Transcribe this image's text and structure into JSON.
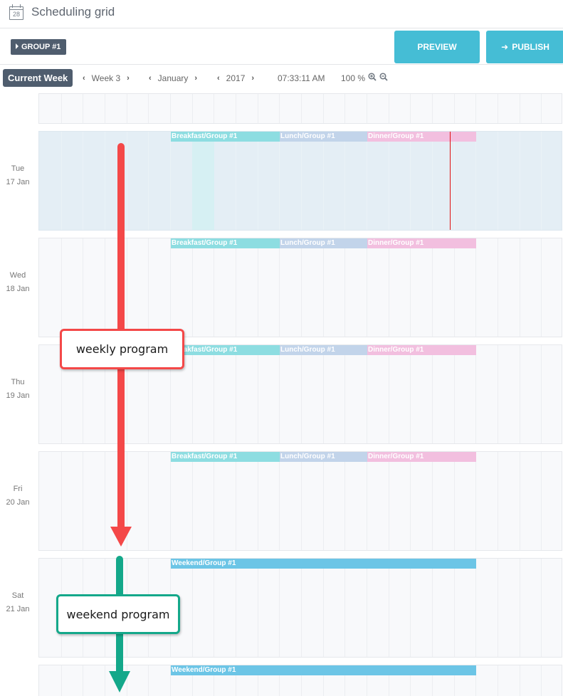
{
  "header": {
    "icon": "calendar-icon",
    "calendar_icon_number": "28",
    "title": "Scheduling grid"
  },
  "toolbar": {
    "group_label": "GROUP #1",
    "preview_label": "PREVIEW",
    "publish_label": "PUBLISH",
    "publish_icon": "arrow-right-icon"
  },
  "navbar": {
    "current_week_label": "Current Week",
    "week": "Week 3",
    "month": "January",
    "year": "2017",
    "clock": "07:33:11 AM",
    "zoom_level": "100 %",
    "zoom_in_icon": "zoom-in-icon",
    "zoom_out_icon": "zoom-out-icon"
  },
  "grid": {
    "hours_per_day": 24,
    "current_time_hour": 18.8,
    "highlight_hour": 7,
    "days": [
      {
        "weekday": "",
        "date": "",
        "partial": true,
        "events": []
      },
      {
        "weekday": "Tue",
        "date": "17 Jan",
        "today": true,
        "events": [
          {
            "label": "Breakfast/Group #1",
            "start": 6,
            "end": 11,
            "color": "#8ddde1"
          },
          {
            "label": "Lunch/Group #1",
            "start": 11,
            "end": 15,
            "color": "#c2d4ea"
          },
          {
            "label": "Dinner/Group #1",
            "start": 15,
            "end": 20,
            "color": "#f2bfdf"
          }
        ]
      },
      {
        "weekday": "Wed",
        "date": "18 Jan",
        "events": [
          {
            "label": "Breakfast/Group #1",
            "start": 6,
            "end": 11,
            "color": "#8ddde1"
          },
          {
            "label": "Lunch/Group #1",
            "start": 11,
            "end": 15,
            "color": "#c2d4ea"
          },
          {
            "label": "Dinner/Group #1",
            "start": 15,
            "end": 20,
            "color": "#f2bfdf"
          }
        ]
      },
      {
        "weekday": "Thu",
        "date": "19 Jan",
        "events": [
          {
            "label": "Breakfast/Group #1",
            "start": 6,
            "end": 11,
            "color": "#8ddde1"
          },
          {
            "label": "Lunch/Group #1",
            "start": 11,
            "end": 15,
            "color": "#c2d4ea"
          },
          {
            "label": "Dinner/Group #1",
            "start": 15,
            "end": 20,
            "color": "#f2bfdf"
          }
        ]
      },
      {
        "weekday": "Fri",
        "date": "20 Jan",
        "events": [
          {
            "label": "Breakfast/Group #1",
            "start": 6,
            "end": 11,
            "color": "#8ddde1"
          },
          {
            "label": "Lunch/Group #1",
            "start": 11,
            "end": 15,
            "color": "#c2d4ea"
          },
          {
            "label": "Dinner/Group #1",
            "start": 15,
            "end": 20,
            "color": "#f2bfdf"
          }
        ]
      },
      {
        "weekday": "Sat",
        "date": "21 Jan",
        "events": [
          {
            "label": "Weekend/Group #1",
            "start": 6,
            "end": 20,
            "color": "#6cc5e6"
          }
        ]
      },
      {
        "weekday": "",
        "date": "",
        "partial": true,
        "events": [
          {
            "label": "Weekend/Group #1",
            "start": 6,
            "end": 20,
            "color": "#6cc5e6"
          }
        ]
      }
    ]
  },
  "annotations": {
    "weekly": {
      "label": "weekly program",
      "color": "#f44848"
    },
    "weekend": {
      "label": "weekend program",
      "color": "#14a88a"
    }
  },
  "colors": {
    "button_accent": "#45bdd5",
    "dark_button": "#4f5d6e",
    "now_line": "#e01010"
  }
}
